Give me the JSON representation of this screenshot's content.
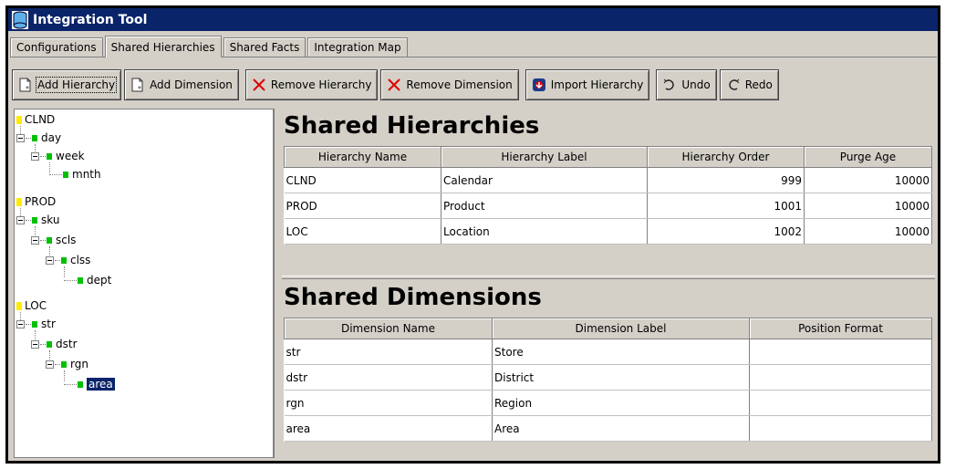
{
  "window": {
    "title": "Integration Tool"
  },
  "tabs": [
    {
      "label": "Configurations"
    },
    {
      "label": "Shared Hierarchies",
      "active": true
    },
    {
      "label": "Shared Facts"
    },
    {
      "label": "Integration Map"
    }
  ],
  "toolbar": {
    "add_hierarchy": "Add Hierarchy",
    "add_dimension": "Add Dimension",
    "remove_hierarchy": "Remove Hierarchy",
    "remove_dimension": "Remove Dimension",
    "import_hierarchy": "Import Hierarchy",
    "undo": "Undo",
    "redo": "Redo"
  },
  "tree": {
    "nodes": [
      {
        "label": "CLND",
        "level": 0,
        "type": "hierarchy"
      },
      {
        "label": "day",
        "level": 1,
        "type": "dimension"
      },
      {
        "label": "week",
        "level": 2,
        "type": "dimension"
      },
      {
        "label": "mnth",
        "level": 3,
        "type": "dimension"
      },
      {
        "label": "PROD",
        "level": 0,
        "type": "hierarchy"
      },
      {
        "label": "sku",
        "level": 1,
        "type": "dimension"
      },
      {
        "label": "scls",
        "level": 2,
        "type": "dimension"
      },
      {
        "label": "clss",
        "level": 3,
        "type": "dimension"
      },
      {
        "label": "dept",
        "level": 4,
        "type": "dimension"
      },
      {
        "label": "LOC",
        "level": 0,
        "type": "hierarchy"
      },
      {
        "label": "str",
        "level": 1,
        "type": "dimension"
      },
      {
        "label": "dstr",
        "level": 2,
        "type": "dimension"
      },
      {
        "label": "rgn",
        "level": 3,
        "type": "dimension"
      },
      {
        "label": "area",
        "level": 4,
        "type": "dimension",
        "selected": true
      }
    ]
  },
  "hierarchies": {
    "title": "Shared Hierarchies",
    "columns": [
      "Hierarchy Name",
      "Hierarchy Label",
      "Hierarchy Order",
      "Purge Age"
    ],
    "rows": [
      [
        "CLND",
        "Calendar",
        "999",
        "10000"
      ],
      [
        "PROD",
        "Product",
        "1001",
        "10000"
      ],
      [
        "LOC",
        "Location",
        "1002",
        "10000"
      ]
    ]
  },
  "dimensions": {
    "title": "Shared Dimensions",
    "columns": [
      "Dimension Name",
      "Dimension Label",
      "Position Format"
    ],
    "rows": [
      [
        "str",
        "Store",
        ""
      ],
      [
        "dstr",
        "District",
        ""
      ],
      [
        "rgn",
        "Region",
        ""
      ],
      [
        "area",
        "Area",
        ""
      ]
    ]
  },
  "colors": {
    "titlebar": "#0a246a",
    "chrome": "#d4d0c8",
    "hierarchy_marker": "#ffea00",
    "dimension_marker": "#00c000"
  }
}
